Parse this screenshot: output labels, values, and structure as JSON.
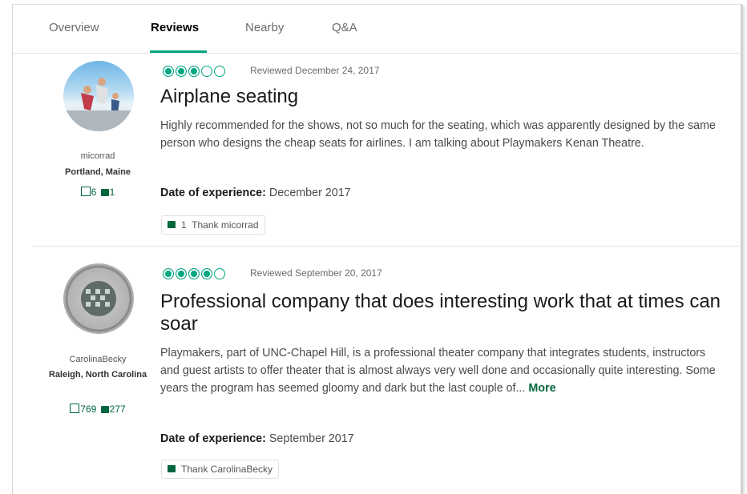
{
  "tabs": [
    {
      "label": "Overview",
      "active": false
    },
    {
      "label": "Reviews",
      "active": true
    },
    {
      "label": "Nearby",
      "active": false
    },
    {
      "label": "Q&A",
      "active": false
    }
  ],
  "reviews": [
    {
      "user": {
        "name": "micorrad",
        "location": "Portland, Maine",
        "contributions": "6",
        "helpful_votes": "1"
      },
      "rating": 3,
      "reviewed_date": "Reviewed December 24, 2017",
      "title": "Airplane seating",
      "body": "Highly recommended for the shows, not so much for the seating, which was apparently designed by the same person who designs the cheap seats for airlines. I am talking about Playmakers Kenan Theatre.",
      "more_label": "",
      "date_label": "Date of experience:",
      "date_value": "December 2017",
      "thank_count": "1",
      "thank_label": "Thank micorrad"
    },
    {
      "user": {
        "name": "CarolinaBecky",
        "location": "Raleigh, North Carolina",
        "contributions": "769",
        "helpful_votes": "277"
      },
      "rating": 4,
      "reviewed_date": "Reviewed September 20, 2017",
      "title": "Professional company that does interesting work that at times can soar",
      "body": "Playmakers, part of UNC-Chapel Hill, is a professional theater company that integrates students, instructors and guest artists to offer theater that is almost always very well done and occasionally quite interesting. Some years the program has seemed gloomy and dark but the last couple of...",
      "more_label": "More",
      "date_label": "Date of experience:",
      "date_value": "September 2017",
      "thank_count": "",
      "thank_label": "Thank CarolinaBecky"
    }
  ],
  "colors": {
    "accent": "#00a680",
    "link_green": "#00663d"
  },
  "icons": [
    "write-review-icon",
    "helpful-vote-icon",
    "thumbs-up-icon",
    "rating-bubble-icon"
  ]
}
